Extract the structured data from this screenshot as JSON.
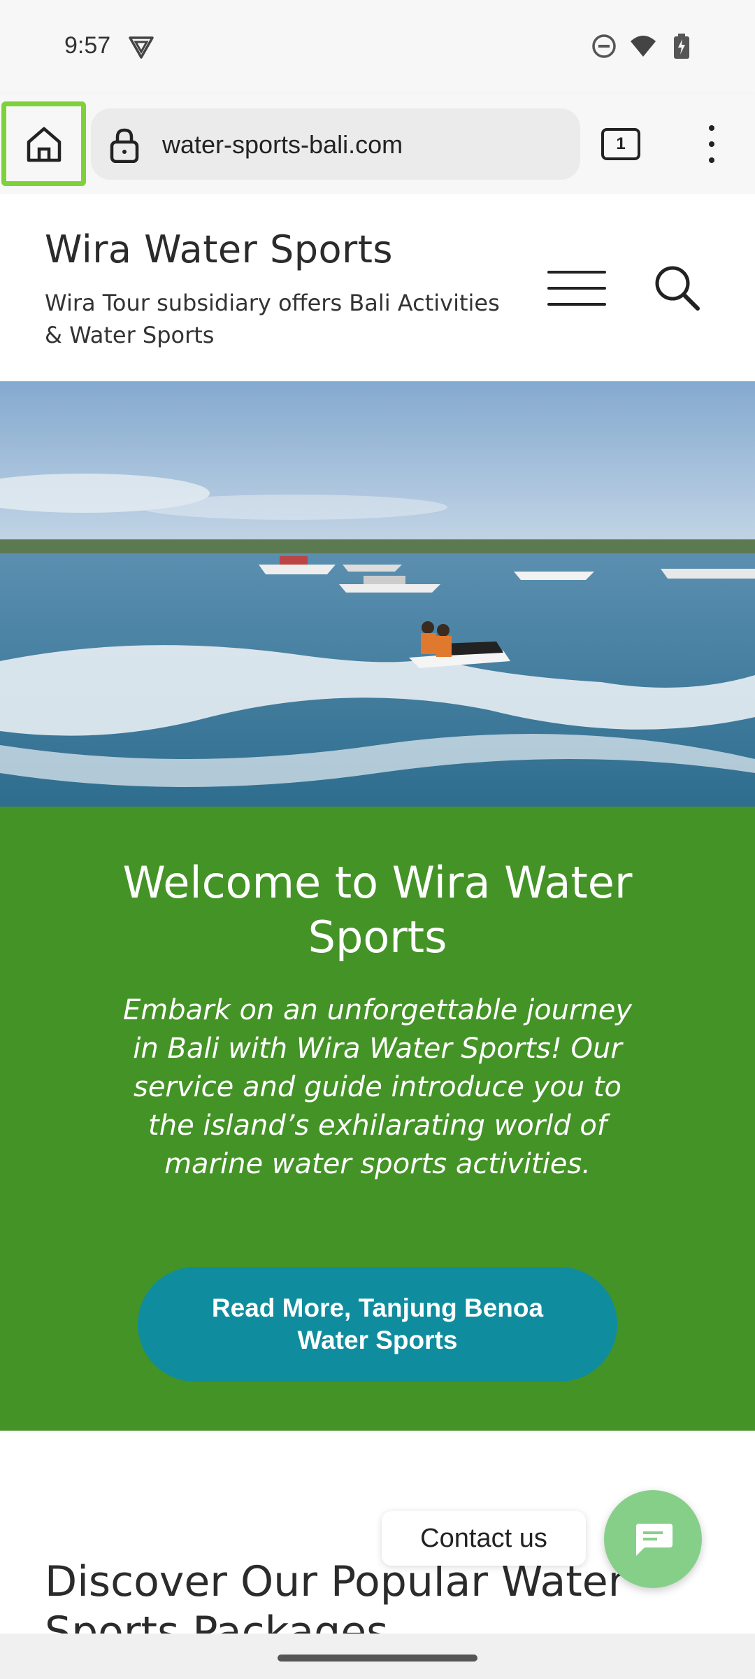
{
  "status_bar": {
    "time": "9:57"
  },
  "browser": {
    "url": "water-sports-bali.com",
    "tab_count": "1"
  },
  "header": {
    "title": "Wira Water Sports",
    "tagline": "Wira Tour subsidiary offers Bali Activities & Water Sports"
  },
  "welcome": {
    "title": "Welcome to Wira Water Sports",
    "text": "Embark on an unforgettable journey in Bali with Wira Water Sports! Our service and guide introduce you to the island’s exhilarating world of marine water sports activities.",
    "button_label": "Read More, Tanjung Benoa Water Sports"
  },
  "discover": {
    "title": "Discover Our Popular Water Sports Packages"
  },
  "contact": {
    "label": "Contact us"
  },
  "colors": {
    "welcome_bg": "#449326",
    "button_bg": "#0f8d9e",
    "contact_bg": "#86cf88",
    "highlight": "#7ed13b"
  }
}
